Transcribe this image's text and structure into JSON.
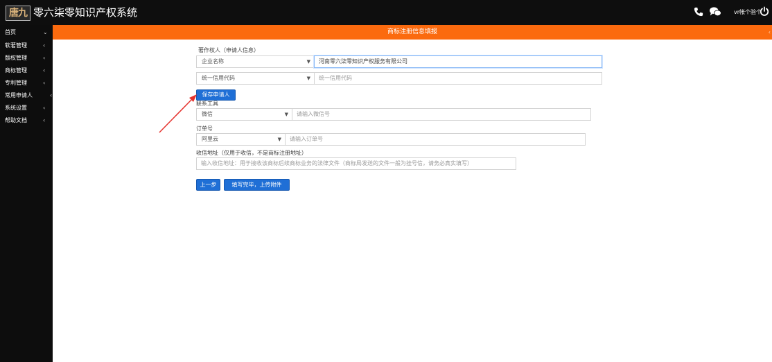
{
  "header": {
    "logo_text": "唐九",
    "app_title": "零六柒零知识产权系统",
    "user_label": "vr帐个验个"
  },
  "sidebar": {
    "items": [
      {
        "label": "首页",
        "chevron": "⌄"
      },
      {
        "label": "软著管理",
        "chevron": "‹"
      },
      {
        "label": "版权管理",
        "chevron": "‹"
      },
      {
        "label": "商标管理",
        "chevron": "‹"
      },
      {
        "label": "专利管理",
        "chevron": "‹"
      },
      {
        "label": "常用申请人",
        "chevron": "‹"
      },
      {
        "label": "系统设置",
        "chevron": "‹"
      },
      {
        "label": "帮助文档",
        "chevron": "‹"
      }
    ]
  },
  "page": {
    "title": "商标注册信息填报",
    "edge_mark": "‹"
  },
  "form": {
    "author_label": "著作权人（申请人信息）",
    "company_select": "企业名称",
    "company_value": "河南零六柒零知识产权服务有限公司",
    "credit_select": "统一信用代码",
    "credit_placeholder": "统一信用代码",
    "save_applicant_btn": "保存申请人",
    "contact_label": "联系工具",
    "contact_select": "微信",
    "contact_placeholder": "请输入微信号",
    "order_label": "订单号",
    "order_select": "阿里云",
    "order_placeholder": "请输入订单号",
    "address_label": "收信地址（仅用于收信，不是商标注册地址）",
    "address_placeholder": "输入收信地址：用于接收该商标后续商标业务的法律文件（商标局发送的文件一般为挂号信，请务必真实填写）",
    "prev_btn": "上一步",
    "next_btn": "填写完毕，上传附件"
  },
  "colors": {
    "accent_orange": "#fb6a0e",
    "button_blue": "#1f6fd6",
    "annotation_red": "#e5322d"
  },
  "icons": {
    "phone": "phone-icon",
    "chat": "chat-icon",
    "power": "power-icon",
    "dropdown": "chevron-down-icon"
  }
}
